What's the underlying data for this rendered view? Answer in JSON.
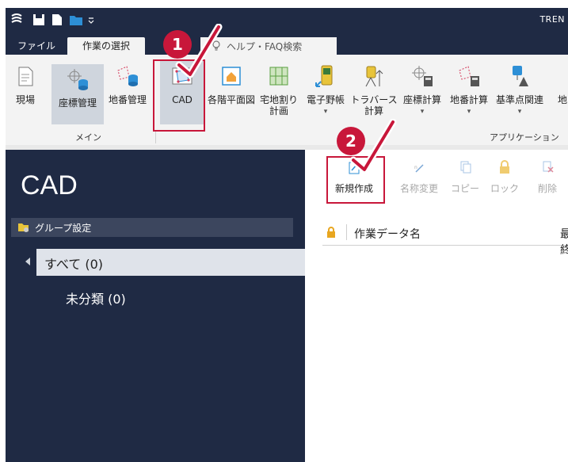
{
  "window": {
    "title": "TREN"
  },
  "menu": {
    "file": "ファイル",
    "active_tab": "作業の選択",
    "help_search": "ヘルプ・FAQ検索"
  },
  "ribbon": {
    "buttons": [
      {
        "label": "現場",
        "icon": "site-icon"
      },
      {
        "label": "座標管理",
        "icon": "coordinate-db-icon"
      },
      {
        "label": "地番管理",
        "icon": "lot-db-icon"
      },
      {
        "label": "CAD",
        "icon": "cad-icon"
      },
      {
        "label": "各階平面図",
        "icon": "floor-plan-icon"
      },
      {
        "label": "宅地割り",
        "label2": "計画",
        "icon": "lot-plan-icon"
      },
      {
        "label": "電子野帳",
        "icon": "field-book-icon"
      },
      {
        "label": "トラバース",
        "label2": "計算",
        "icon": "traverse-icon"
      },
      {
        "label": "座標計算",
        "icon": "coord-calc-icon"
      },
      {
        "label": "地番計算",
        "icon": "lot-calc-icon"
      },
      {
        "label": "基準点関連",
        "icon": "benchmark-icon"
      },
      {
        "label": "地",
        "icon": "more-icon"
      }
    ],
    "groups": {
      "main": "メイン",
      "app": "アプリケーション"
    }
  },
  "left_panel": {
    "title": "CAD",
    "group_setting": "グループ設定",
    "tree": {
      "all": "すべて (0)",
      "uncategorized": "未分類 (0)"
    }
  },
  "toolbar": {
    "new": "新規作成",
    "rename": "名称変更",
    "copy": "コピー",
    "lock": "ロック",
    "delete": "削除"
  },
  "list": {
    "col_name": "作業データ名",
    "col_last": "最終"
  },
  "annotations": {
    "step1": "1",
    "step2": "2"
  },
  "colors": {
    "accent": "#c8173a",
    "dark": "#1f2a44",
    "ribbon": "#f3f3f3"
  }
}
